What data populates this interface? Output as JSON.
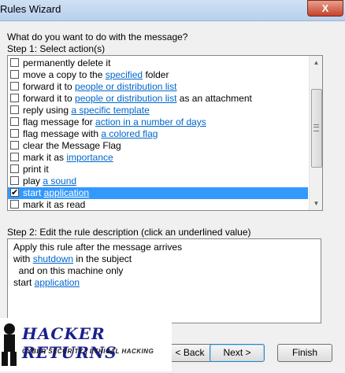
{
  "window": {
    "title": "Rules Wizard",
    "close_glyph": "X"
  },
  "prompt": "What do you want to do with the message?",
  "step1": {
    "label": "Step 1: Select action(s)",
    "actions": [
      {
        "pre": "permanently delete it",
        "link": "",
        "post": "",
        "checked": false,
        "selected": false
      },
      {
        "pre": "move a copy to the ",
        "link": "specified",
        "post": " folder",
        "checked": false,
        "selected": false
      },
      {
        "pre": "forward it to ",
        "link": "people or distribution list",
        "post": "",
        "checked": false,
        "selected": false
      },
      {
        "pre": "forward it to ",
        "link": "people or distribution list",
        "post": " as an attachment",
        "checked": false,
        "selected": false
      },
      {
        "pre": "reply using ",
        "link": "a specific template",
        "post": "",
        "checked": false,
        "selected": false
      },
      {
        "pre": "flag message for ",
        "link": "action in a number of days",
        "post": "",
        "checked": false,
        "selected": false
      },
      {
        "pre": "flag message with ",
        "link": "a colored flag",
        "post": "",
        "checked": false,
        "selected": false
      },
      {
        "pre": "clear the Message Flag",
        "link": "",
        "post": "",
        "checked": false,
        "selected": false
      },
      {
        "pre": "mark it as ",
        "link": "importance",
        "post": "",
        "checked": false,
        "selected": false
      },
      {
        "pre": "print it",
        "link": "",
        "post": "",
        "checked": false,
        "selected": false
      },
      {
        "pre": "play ",
        "link": "a sound",
        "post": "",
        "checked": false,
        "selected": false
      },
      {
        "pre": "start ",
        "link": "application",
        "post": "",
        "checked": true,
        "selected": true
      },
      {
        "pre": "mark it as read",
        "link": "",
        "post": "",
        "checked": false,
        "selected": false
      }
    ]
  },
  "step2": {
    "label": "Step 2: Edit the rule description (click an underlined value)",
    "lines": [
      {
        "pre": "Apply this rule after the message arrives",
        "link": "",
        "post": ""
      },
      {
        "pre": "with ",
        "link": "shutdown",
        "post": " in the subject"
      },
      {
        "pre": "  and on this machine only",
        "link": "",
        "post": ""
      },
      {
        "pre": "start ",
        "link": "application",
        "post": ""
      }
    ]
  },
  "buttons": {
    "back": "< Back",
    "next": "Next >",
    "finish": "Finish"
  },
  "watermark": {
    "title": "HACKER RETURNS",
    "subtitle": "CYBER SECURITY | ETHICAL HACKING"
  },
  "colors": {
    "selection": "#3399ff",
    "link": "#0066cc",
    "check": "✔"
  }
}
